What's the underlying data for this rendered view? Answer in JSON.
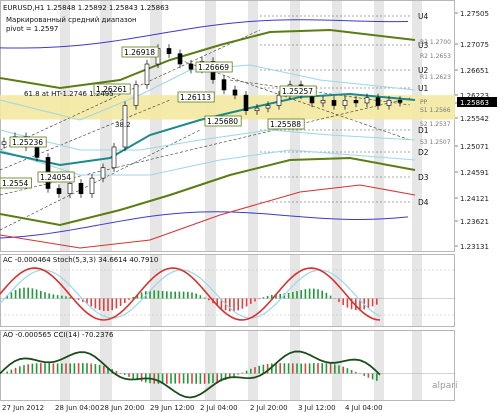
{
  "chart_data": [
    {
      "type": "candlestick",
      "symbol_line": "EURUSD,H1  1.25848 1.25892 1.25843 1.25863",
      "notes": [
        "Маркированный средний диапазон",
        "pivot = 1.2597"
      ],
      "fib_label": "61.8 at HT-1.2746 1.2495",
      "label_38": "38.2",
      "y_ticks": [
        "1.27505",
        "1.27075",
        "1.26651",
        "1.26223",
        "1.25863",
        "1.25542",
        "1.25071",
        "1.24591",
        "1.24121",
        "1.23621",
        "1.23131"
      ],
      "ylim": [
        1.2313,
        1.2768
      ],
      "x_ticks": [
        "27 Jun 2012",
        "28 Jun 04:00",
        "28 Jun 20:00",
        "29 Jun 12:00",
        "2 Jul 04:00",
        "2 Jul 20:00",
        "3 Jul 12:00",
        "4 Jul 04:00"
      ],
      "last_price": "1.25863",
      "price_tags": [
        "1.26918",
        "1.26261",
        "1.26669",
        "1.26113",
        "1.25257",
        "1.25680",
        "1.25588",
        "1.25236",
        "1.24054",
        "1.2554"
      ],
      "levels": [
        "U4",
        "U3",
        "U2",
        "U1",
        "D1",
        "D2",
        "D3",
        "D4"
      ],
      "level_tags": [
        "R3 1.2700",
        "R2 1.2653",
        "R1 1.2623",
        "S1 1.2566",
        "S2 1.2537",
        "S3 1.2507"
      ],
      "pivot_tag": "PP"
    },
    {
      "type": "line",
      "title": "AC -0.000464  Stoch(5,3,3) 34.6614 40.7910",
      "y_ticks": [
        "0.000527",
        "80",
        "20",
        "-0.00317"
      ]
    },
    {
      "type": "line",
      "title": "AO -0.000565  CCI(14) -70.2376",
      "y_ticks": [
        "0.016635",
        "0.00",
        "-0.00556"
      ]
    }
  ],
  "watermark": "alpari",
  "colors": {
    "bull": "#1e9a3a",
    "bear": "#e04040",
    "candle": "#000000",
    "band_blue": "#3a3acf",
    "band_green": "#5a7d12",
    "band_cyan": "#9dd6e8",
    "ma_teal": "#1b8a8a",
    "red": "#d83030",
    "zone": "#f3e9a2",
    "vstripe": "#e6e6e6"
  }
}
